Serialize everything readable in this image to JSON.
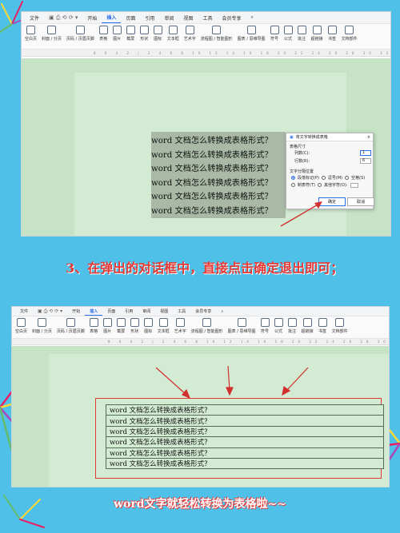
{
  "menu": {
    "file": "文件",
    "tabs": [
      "开始",
      "插入",
      "页面",
      "引用",
      "审阅",
      "视图",
      "工具",
      "会员专享"
    ],
    "active_tab": "插入"
  },
  "ribbon": {
    "items": [
      {
        "label": "空白页",
        "icon": "blank-page-icon"
      },
      {
        "label": "封面 / 分页",
        "icon": "cover-icon"
      },
      {
        "label": "页码 / 页眉页脚",
        "icon": "page-number-icon"
      },
      {
        "label": "表格",
        "icon": "table-icon"
      },
      {
        "label": "图片",
        "icon": "picture-icon"
      },
      {
        "label": "截屏",
        "icon": "screenshot-icon"
      },
      {
        "label": "形状",
        "icon": "shape-icon"
      },
      {
        "label": "图标",
        "icon": "icon-icon"
      },
      {
        "label": "文本框",
        "icon": "textbox-icon"
      },
      {
        "label": "艺术字",
        "icon": "wordart-icon"
      },
      {
        "label": "流程图 / 智能图形",
        "icon": "flowchart-icon"
      },
      {
        "label": "图表 / 思维导图",
        "icon": "chart-icon"
      },
      {
        "label": "符号",
        "icon": "symbol-icon"
      },
      {
        "label": "公式",
        "icon": "formula-icon"
      },
      {
        "label": "批注",
        "icon": "comment-icon"
      },
      {
        "label": "超链接",
        "icon": "hyperlink-icon"
      },
      {
        "label": "书签",
        "icon": "bookmark-icon"
      },
      {
        "label": "文档部件",
        "icon": "doc-parts-icon"
      }
    ]
  },
  "document": {
    "lines": [
      "word 文档怎么转换成表格形式？",
      "word 文档怎么转换成表格形式？",
      "word 文档怎么转换成表格形式？",
      "word 文档怎么转换成表格形式？",
      "word 文档怎么转换成表格形式？",
      "word 文档怎么转换成表格形式？"
    ]
  },
  "dialog": {
    "title": "将文字转换成表格",
    "size_section": "表格尺寸",
    "columns_label": "列数(C):",
    "columns_value": "1",
    "rows_label": "行数(R):",
    "rows_value": "6",
    "separator_section": "文字分隔位置",
    "options": [
      "段落标记(P)",
      "逗号(M)",
      "空格(S)",
      "制表符(T)",
      "其他字符(O):"
    ],
    "selected_option": "段落标记(P)",
    "ok": "确定",
    "cancel": "取消"
  },
  "caption1": "3、在弹出的对话框中，直接点击确定退出即可；",
  "caption2": "word文字就轻松转换为表格啦~~",
  "colors": {
    "background": "#4fc1e9",
    "accent": "#2a6ee8",
    "caption": "#e53935",
    "arrow": "#d32f2f"
  }
}
